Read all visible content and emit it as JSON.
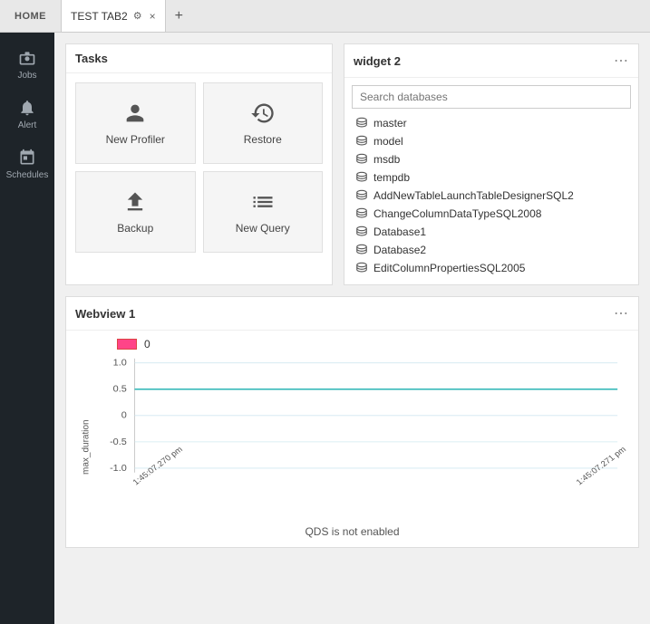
{
  "topbar": {
    "home_label": "HOME",
    "tab_title": "TEST TAB2",
    "tab_add_label": "+",
    "tab_close": "×"
  },
  "sidebar": {
    "items": [
      {
        "id": "jobs",
        "label": "Jobs",
        "icon": "briefcase"
      },
      {
        "id": "alert",
        "label": "Alert",
        "icon": "bell"
      },
      {
        "id": "schedules",
        "label": "Schedules",
        "icon": "calendar"
      }
    ]
  },
  "tasks_widget": {
    "title": "Tasks",
    "items": [
      {
        "id": "new-profiler",
        "label": "New Profiler",
        "icon": "👤"
      },
      {
        "id": "restore",
        "label": "Restore",
        "icon": "↩"
      },
      {
        "id": "backup",
        "label": "Backup",
        "icon": "⬆"
      },
      {
        "id": "new-query",
        "label": "New Query",
        "icon": "≡"
      }
    ],
    "menu_label": "⋯"
  },
  "widget2": {
    "title": "widget 2",
    "menu_label": "⋯",
    "search_placeholder": "Search databases",
    "databases": [
      {
        "name": "master"
      },
      {
        "name": "model"
      },
      {
        "name": "msdb"
      },
      {
        "name": "tempdb"
      },
      {
        "name": "AddNewTableLaunchTableDesignerSQL2"
      },
      {
        "name": "ChangeColumnDataTypeSQL2008"
      },
      {
        "name": "Database1"
      },
      {
        "name": "Database2"
      },
      {
        "name": "EditColumnPropertiesSQL2005"
      }
    ]
  },
  "webview": {
    "title": "Webview 1",
    "menu_label": "⋯",
    "legend_label": "0",
    "y_axis_label": "max_duration",
    "x_left_label": "1:45:07.270 pm",
    "x_right_label": "1:45:07.271 pm",
    "footer_text": "QDS is not enabled",
    "y_ticks": [
      "1.0",
      "0.5",
      "0",
      "-0.5",
      "-1.0"
    ],
    "chart_line_value": 0.5
  }
}
